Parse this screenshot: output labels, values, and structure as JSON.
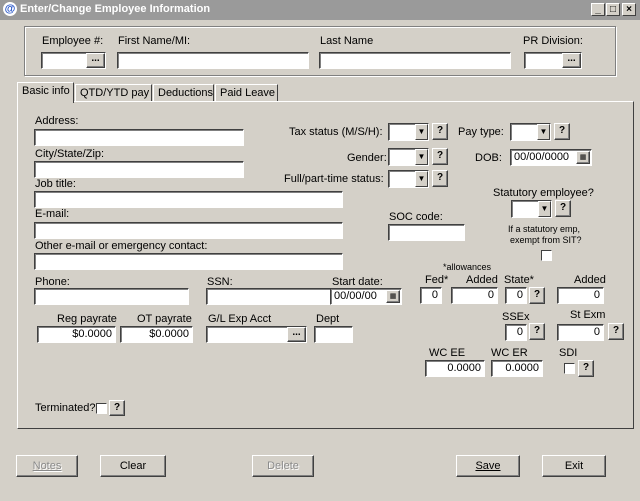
{
  "window": {
    "title": "Enter/Change Employee Information",
    "icon": "@"
  },
  "header": {
    "employee_no_label": "Employee #:",
    "first_name_label": "First Name/MI:",
    "last_name_label": "Last Name",
    "pr_division_label": "PR Division:"
  },
  "tabs": [
    "Basic info",
    "QTD/YTD pay",
    "Deductions",
    "Paid Leave"
  ],
  "basic": {
    "address_label": "Address:",
    "city_label": "City/State/Zip:",
    "job_title_label": "Job title:",
    "email_label": "E-mail:",
    "other_contact_label": "Other e-mail or emergency contact:",
    "phone_label": "Phone:",
    "ssn_label": "SSN:",
    "start_date_label": "Start date:",
    "start_date_value": "00/00/00",
    "reg_payrate_label": "Reg payrate",
    "reg_payrate_value": "$0.0000",
    "ot_payrate_label": "OT payrate",
    "ot_payrate_value": "$0.0000",
    "gl_label": "G/L Exp Acct",
    "dept_label": "Dept",
    "tax_status_label": "Tax status (M/S/H):",
    "gender_label": "Gender:",
    "fullpart_label": "Full/part-time status:",
    "pay_type_label": "Pay type:",
    "dob_label": "DOB:",
    "dob_value": "00/00/0000",
    "statutory_label": "Statutory employee?",
    "soc_label": "SOC code:",
    "sit_note_1": "If a statutory emp,",
    "sit_note_2": "exempt from SIT?",
    "allowances_label": "*allowances",
    "fed_label": "Fed*",
    "fed_value": "0",
    "added_label": "Added",
    "added_value": "0",
    "state_label": "State*",
    "state_value": "0",
    "state_added_label": "Added",
    "state_added_value": "0",
    "ssex_label": "SSEx",
    "ssex_value": "0",
    "st_exm_label": "St Exm",
    "st_exm_value": "0",
    "wc_ee_label": "WC EE",
    "wc_ee_value": "0.0000",
    "wc_er_label": "WC ER",
    "wc_er_value": "0.0000",
    "sdi_label": "SDI",
    "terminated_label": "Terminated?"
  },
  "buttons": {
    "notes": "Notes",
    "clear": "Clear",
    "delete": "Delete",
    "save": "Save",
    "exit": "Exit",
    "help": "?",
    "lookup": "..."
  }
}
